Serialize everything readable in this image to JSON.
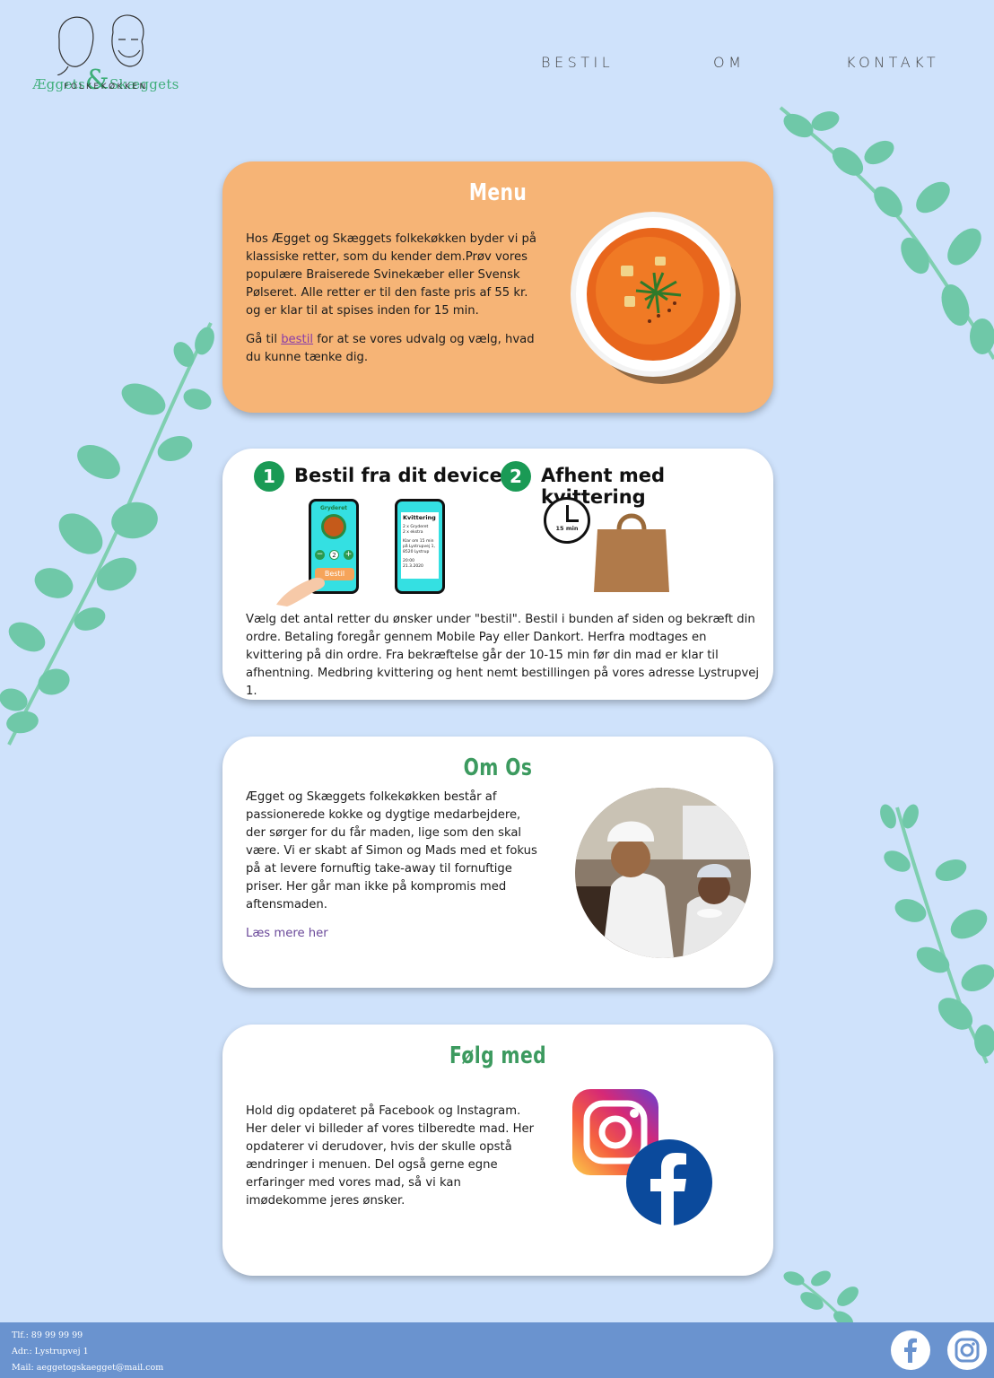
{
  "brand": {
    "name_left": "Æggets",
    "ampersand": "&",
    "name_right": "Skæggets",
    "subtitle": "FOLKEKØKKEN"
  },
  "nav": {
    "items": [
      {
        "label": "BESTIL"
      },
      {
        "label": "OM"
      },
      {
        "label": "KONTAKT"
      }
    ]
  },
  "menu_card": {
    "title": "Menu",
    "paragraph1": "Hos Ægget og Skæggets folkekøkken byder vi på klassiske retter, som du kender dem.Prøv vores populære Braiserede Svinekæber eller Svensk Pølseret. Alle retter er til den faste pris af 55 kr. og er klar til at spises inden for 15 min.",
    "paragraph2_before": "Gå til ",
    "paragraph2_link": "bestil",
    "paragraph2_after": " for at se vores udvalg og vælg, hvad du kunne tænke dig.",
    "image": "soup-bowl"
  },
  "howto_card": {
    "step1_number": "1",
    "step1_label": "Bestil fra dit device",
    "step2_number": "2",
    "step2_label": "Afhent med kvittering",
    "phone1_header": "Gryderet",
    "phone1_qty": "2",
    "phone1_button": "Bestil",
    "phone2_header": "Kvittering",
    "phone2_lines": [
      "2 x Gryderet",
      "2 x ekstra",
      "",
      "Klar om 15 min",
      "på Lystrupvej 1,",
      "8520 Lystrup",
      "",
      "20:00",
      "21.3.2020"
    ],
    "clock_label": "15 min",
    "description": "Vælg det antal retter du ønsker under \"bestil\". Bestil i bunden af siden og bekræft din ordre. Betaling foregår gennem Mobile Pay eller Dankort. Herfra modtages en kvittering på din ordre. Fra bekræftelse går der 10-15 min før din mad er klar til afhentning. Medbring kvittering og hent nemt bestillingen på vores adresse Lystrupvej 1."
  },
  "about_card": {
    "title": "Om Os",
    "paragraph": "Ægget og Skæggets folkekøkken består af passionerede kokke og dygtige medarbejdere, der sørger for du får maden, lige som den skal være. Vi er skabt af Simon og Mads med et fokus på at levere fornuftig take-away til fornuftige priser. Her går man ikke på kompromis med aftensmaden.",
    "link": "Læs mere her",
    "image": "chefs-photo"
  },
  "follow_card": {
    "title": "Følg med",
    "paragraph": "Hold dig opdateret på Facebook og Instagram. Her deler vi billeder af vores tilberedte mad. Her opdaterer vi derudover, hvis der skulle opstå ændringer i menuen. Del også gerne egne erfaringer med vores mad, så vi kan imødekomme jeres ønsker.",
    "icons": [
      "instagram-icon",
      "facebook-icon"
    ]
  },
  "footer": {
    "phone": "Tlf.: 89 99 99 99",
    "address": "Adr.: Lystrupvej 1",
    "mail": "Mail: aeggetogskaegget@mail.com",
    "icons": [
      "facebook-icon",
      "instagram-icon"
    ]
  },
  "colors": {
    "background": "#cfe2fb",
    "accent_green": "#3c9a5f",
    "menu_card": "#f6b476",
    "footer": "#6a93cf",
    "facebook": "#0b4a9c"
  }
}
